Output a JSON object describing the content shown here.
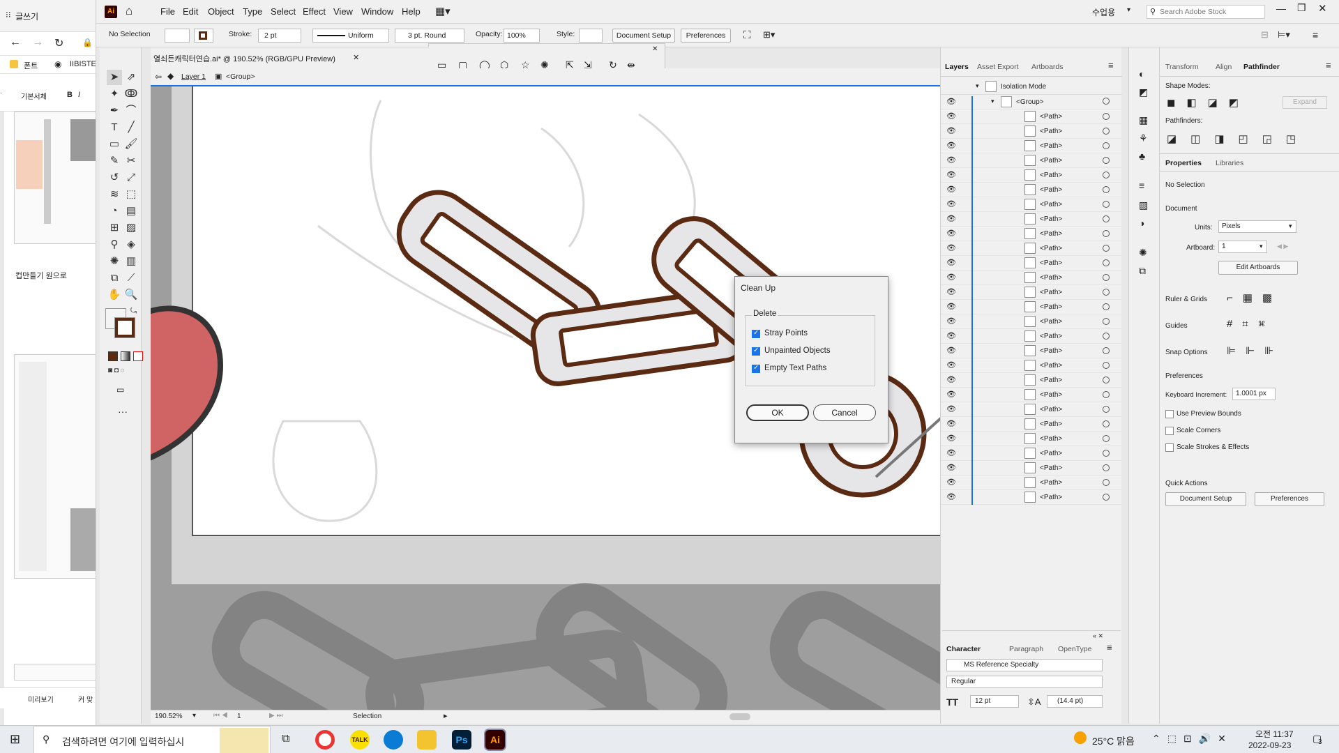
{
  "browser": {
    "tab_title": "글쓰기",
    "bookmark_font": "폰트",
    "bookmark_iibis": "IIBISTE",
    "toolbar_label": "기본서체",
    "section_label": "컵만들기 원으로",
    "bottom_label": "미리보기",
    "bottom_label2": "커 맞"
  },
  "menubar": {
    "logo": "Ai",
    "items": [
      "File",
      "Edit",
      "Object",
      "Type",
      "Select",
      "Effect",
      "View",
      "Window",
      "Help"
    ],
    "workspace": "수업용",
    "search_placeholder": "Search Adobe Stock"
  },
  "control": {
    "selection": "No Selection",
    "stroke_label": "Stroke:",
    "stroke_value": "2 pt",
    "uniform": "Uniform",
    "brush": "3 pt. Round",
    "opacity_label": "Opacity:",
    "opacity_value": "100%",
    "style_label": "Style:",
    "doc_setup": "Document Setup",
    "preferences": "Preferences"
  },
  "document": {
    "tab_title": "열쇠든캐릭터연습.ai* @ 190.52% (RGB/GPU Preview)",
    "layer": "Layer 1",
    "group": "<Group>",
    "zoom": "190.52%",
    "artboard": "1",
    "status": "Selection"
  },
  "layers_panel": {
    "tabs": [
      "Layers",
      "Asset Export",
      "Artboards"
    ],
    "isolation": "Isolation Mode",
    "group": "<Group>",
    "path_label": "<Path>",
    "path_count": 27
  },
  "character_panel": {
    "tabs": [
      "Character",
      "Paragraph",
      "OpenType"
    ],
    "font": "MS Reference Specialty",
    "style": "Regular",
    "size": "12 pt",
    "leading": "(14.4 pt)"
  },
  "right_panel": {
    "tabs_top": [
      "Transform",
      "Align",
      "Pathfinder"
    ],
    "shape_modes": "Shape Modes:",
    "expand": "Expand",
    "pathfinders": "Pathfinders:",
    "tabs_props": [
      "Properties",
      "Libraries"
    ],
    "no_selection": "No Selection",
    "document": "Document",
    "units_label": "Units:",
    "units_value": "Pixels",
    "artboard_label": "Artboard:",
    "artboard_value": "1",
    "edit_artboards": "Edit Artboards",
    "ruler_grids": "Ruler & Grids",
    "guides": "Guides",
    "snap_options": "Snap Options",
    "preferences": "Preferences",
    "kb_label": "Keyboard Increment:",
    "kb_value": "1.0001 px",
    "use_preview": "Use Preview Bounds",
    "scale_corners": "Scale Corners",
    "scale_strokes": "Scale Strokes & Effects",
    "quick_actions": "Quick Actions",
    "doc_setup": "Document Setup",
    "prefs_btn": "Preferences"
  },
  "dialog": {
    "title": "Clean Up",
    "group": "Delete",
    "options": [
      {
        "label": "Stray Points",
        "checked": true
      },
      {
        "label": "Unpainted Objects",
        "checked": true
      },
      {
        "label": "Empty Text Paths",
        "checked": true
      }
    ],
    "ok": "OK",
    "cancel": "Cancel"
  },
  "taskbar": {
    "search_placeholder": "검색하려면 여기에 입력하십시",
    "weather": "25°C 맑음",
    "time": "오전 11:37",
    "date": "2022-09-23",
    "notif": "3",
    "kakao": "TALK",
    "ps": "Ps",
    "ai": "Ai"
  },
  "colors": {
    "chain_stroke": "#5a2a12",
    "chain_fill": "#e6e6e8",
    "accent": "#1473e6",
    "heart": "#e06060"
  }
}
